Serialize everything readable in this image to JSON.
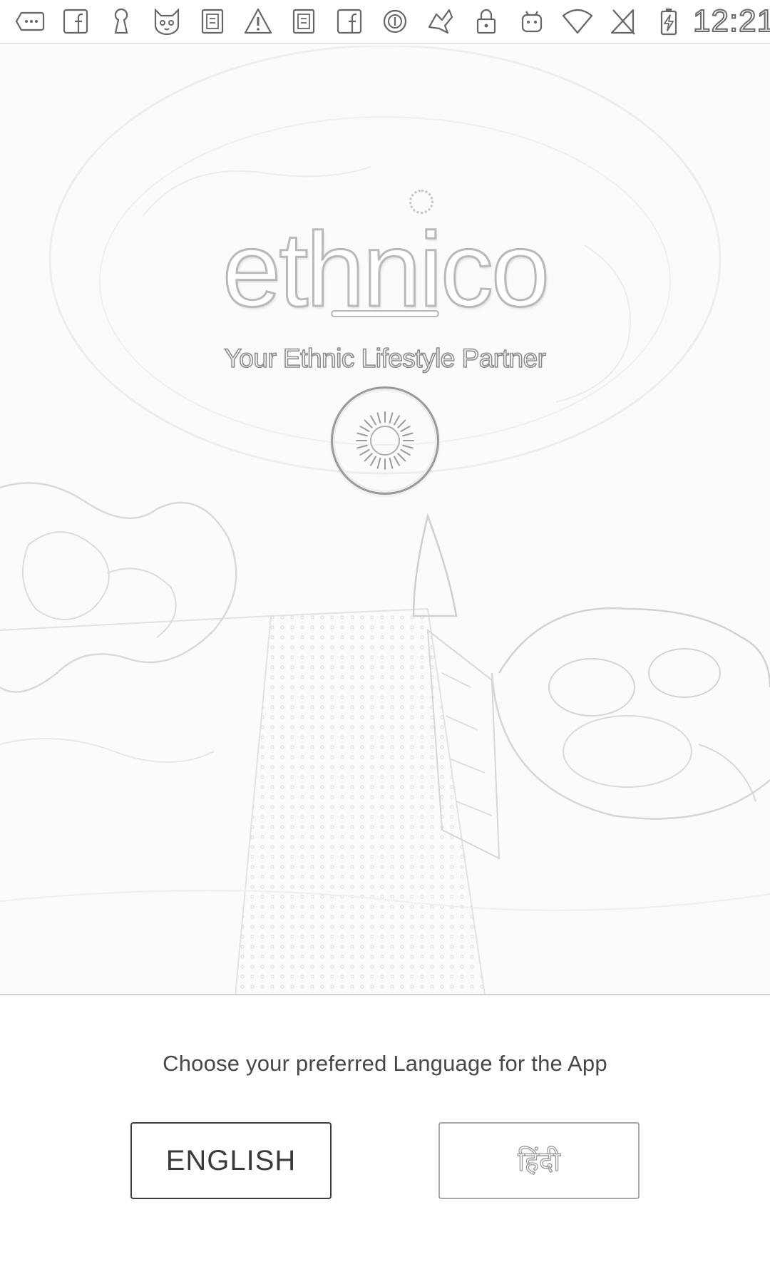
{
  "status_bar": {
    "icons": [
      "more-notifications-icon",
      "facebook-icon",
      "keyhole-icon",
      "cat-app-icon",
      "app-notification-icon",
      "warning-icon",
      "app-notification-icon",
      "facebook-icon",
      "circle-app-icon",
      "game-app-icon",
      "lock-icon",
      "android-icon",
      "wifi-icon",
      "no-sim-icon",
      "battery-charging-icon"
    ],
    "time": "12:21"
  },
  "hero": {
    "brand": "ethnico",
    "tagline": "Your Ethnic Lifestyle Partner",
    "loading_icon": "loading-spinner-icon"
  },
  "language": {
    "prompt": "Choose your preferred Language for the App",
    "english_label": "ENGLISH",
    "hindi_label": "हिंदी"
  }
}
